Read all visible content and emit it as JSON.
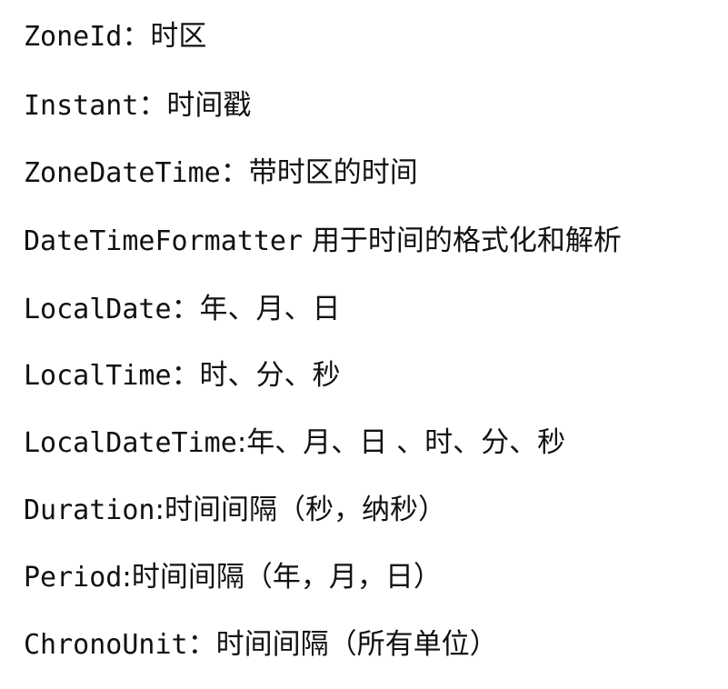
{
  "lines": [
    {
      "term": "ZoneId",
      "desc": "：时区"
    },
    {
      "term": "Instant",
      "desc": "：时间戳"
    },
    {
      "term": "ZoneDateTime",
      "desc": "：带时区的时间"
    },
    {
      "term": "DateTimeFormatter",
      "desc": " 用于时间的格式化和解析"
    },
    {
      "term": "LocalDate",
      "desc": "：年、月、日"
    },
    {
      "term": "LocalTime",
      "desc": "：时、分、秒"
    },
    {
      "term": "LocalDateTime",
      "desc": ":年、月、日 、时、分、秒"
    },
    {
      "term": "Duration",
      "desc": ":时间间隔（秒，纳秒）"
    },
    {
      "term": "Period",
      "desc": ":时间间隔（年，月，日）"
    },
    {
      "term": "ChronoUnit",
      "desc": "：时间间隔（所有单位）"
    }
  ]
}
